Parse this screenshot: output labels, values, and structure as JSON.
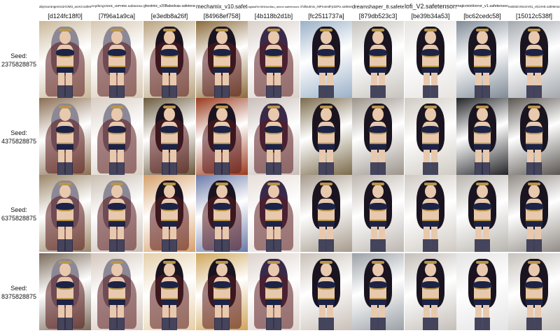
{
  "columns": [
    {
      "model": "abyssorangemix3AOM3_aom3.safetensors",
      "hash": "[d124fc18f0]"
    },
    {
      "model": "AnythingV5Ink_v5PrtRE.safetensors",
      "hash": "[7f96a1a9ca]"
    },
    {
      "model": "ghostmix_v20Bakedvae.safetensors",
      "hash": "[e3edb8a26f]"
    },
    {
      "model": "mechamix_v10.safetensors",
      "hash": "[84968ef758]"
    },
    {
      "model": "aglaiaReV6NNonBau_anime.safetensors",
      "hash": "[4b118b2d1b]"
    },
    {
      "model": "chilloutmix_NiPrunedFp32Fix.safetensors",
      "hash": "[fc2511737a]"
    },
    {
      "model": "dreamshaper_8.safetensors",
      "hash": "[879db523c3]"
    },
    {
      "model": "lofi_V2.safetensors",
      "hash": "[be39b34a53]"
    },
    {
      "model": "majicmixHorror_v1.safetensors",
      "hash": "[bc62cedc58]"
    },
    {
      "model": "realisticVisionV51_v51VAE.safetensors",
      "hash": "[15012c538f]"
    }
  ],
  "rows": [
    {
      "label_line1": "Seed:",
      "label_line2": "2375828875"
    },
    {
      "label_line1": "Seed:",
      "label_line2": "4375828875"
    },
    {
      "label_line1": "Seed:",
      "label_line2": "6375828875"
    },
    {
      "label_line1": "Seed:",
      "label_line2": "8375828875"
    }
  ],
  "colors": {
    "hair_dark": "#1a1420",
    "hair_purple": "#3a2a4a",
    "hair_silver": "#8c8896",
    "skin": "#e8c9ae",
    "navy": "#1c2346",
    "gold": "#b9954a",
    "cape_red": "#5a1a1e"
  }
}
